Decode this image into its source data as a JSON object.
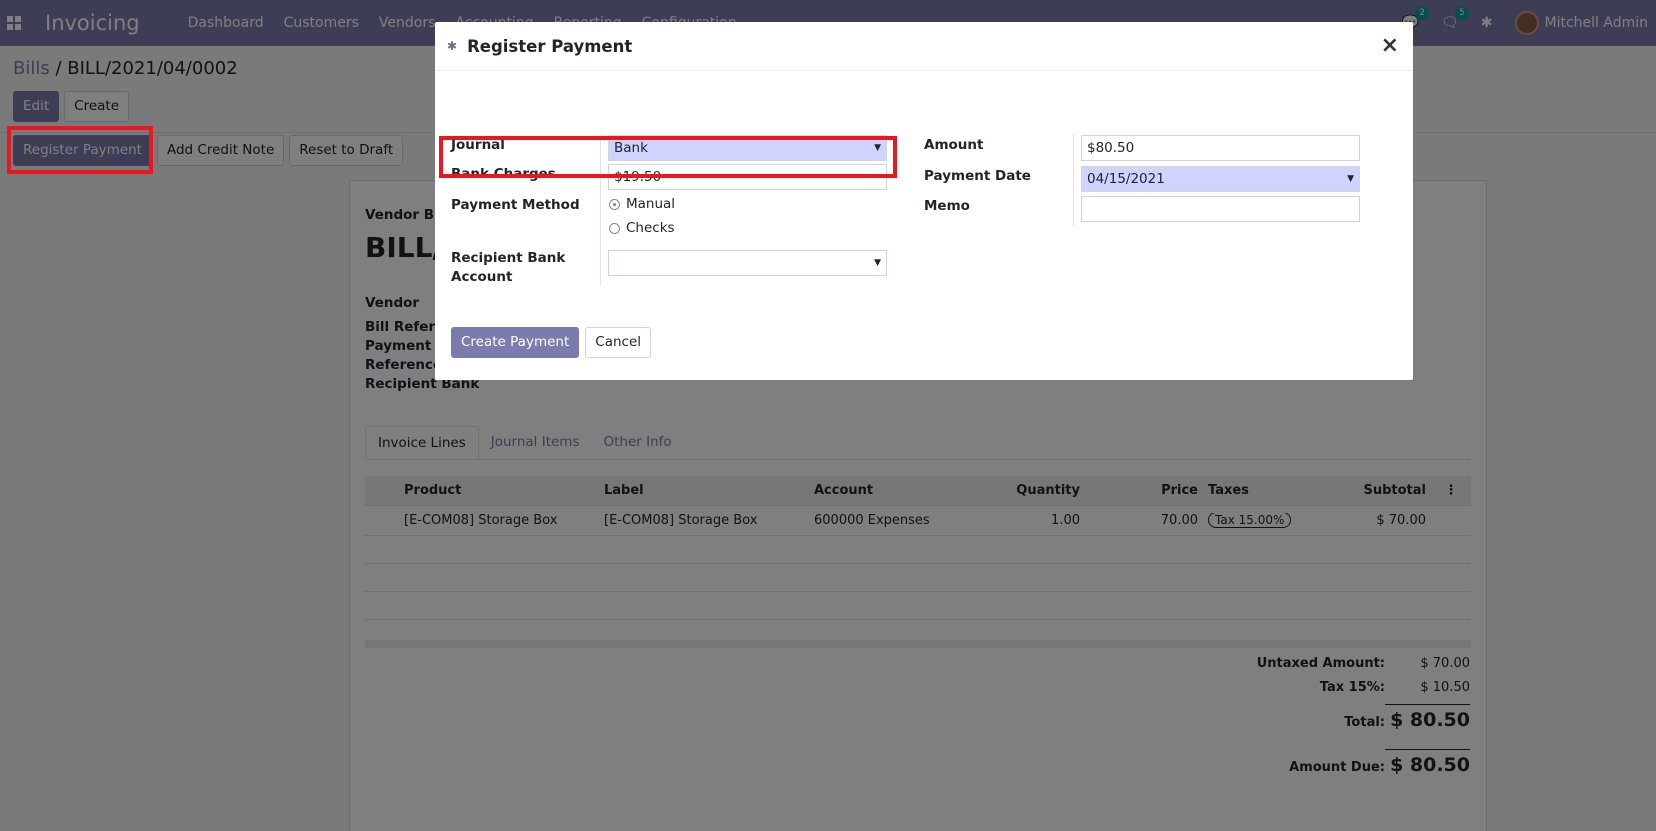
{
  "navbar": {
    "app_name": "Invoicing",
    "menu": [
      "Dashboard",
      "Customers",
      "Vendors",
      "Accounting",
      "Reporting",
      "Configuration"
    ],
    "chat_count": "2",
    "activity_count": "5",
    "user_name": "Mitchell Admin"
  },
  "breadcrumb": {
    "parent": "Bills",
    "separator": " / ",
    "current": "BILL/2021/04/0002"
  },
  "control_panel": {
    "edit_label": "Edit",
    "create_label": "Create"
  },
  "status_buttons": {
    "register_payment_label": "Register Payment",
    "add_credit_note_label": "Add Credit Note",
    "reset_to_draft_label": "Reset to Draft"
  },
  "sheet": {
    "bill_type": "Vendor Bi",
    "bill_number": "BILL/",
    "fields": [
      "Vendor",
      "Bill Refere",
      "Payment",
      "Reference",
      "Recipient Bank"
    ],
    "tabs": [
      "Invoice Lines",
      "Journal Items",
      "Other Info"
    ],
    "columns": [
      "Product",
      "Label",
      "Account",
      "Quantity",
      "Price",
      "Taxes",
      "Subtotal"
    ],
    "lines": [
      {
        "product": "[E-COM08] Storage Box",
        "label": "[E-COM08] Storage Box",
        "account": "600000 Expenses",
        "quantity": "1.00",
        "price": "70.00",
        "tax": "Tax 15.00%",
        "subtotal": "$ 70.00"
      }
    ],
    "totals": {
      "untaxed_label": "Untaxed Amount:",
      "untaxed_value": "$ 70.00",
      "tax_label": "Tax 15%:",
      "tax_value": "$ 10.50",
      "total_label": "Total:",
      "total_value": "$ 80.50",
      "due_label": "Amount Due:",
      "due_value": "$ 80.50"
    }
  },
  "modal": {
    "title": "Register Payment",
    "close_symbol": "×",
    "journal_label": "Journal",
    "journal_value": "Bank",
    "bank_charges_label": "Bank Charges",
    "bank_charges_value": "$19.50",
    "payment_method_label": "Payment Method",
    "payment_methods": [
      "Manual",
      "Checks"
    ],
    "selected_payment_method": "Manual",
    "recipient_bank_label": "Recipient Bank Account",
    "recipient_bank_value": "",
    "amount_label": "Amount",
    "amount_value": "$80.50",
    "payment_date_label": "Payment Date",
    "payment_date_value": "04/15/2021",
    "memo_label": "Memo",
    "memo_value": "",
    "create_payment_label": "Create Payment",
    "cancel_label": "Cancel"
  },
  "colors": {
    "brand": "#7c7bad",
    "highlight": "#e8181e",
    "required_field": "#d2d2ff"
  }
}
